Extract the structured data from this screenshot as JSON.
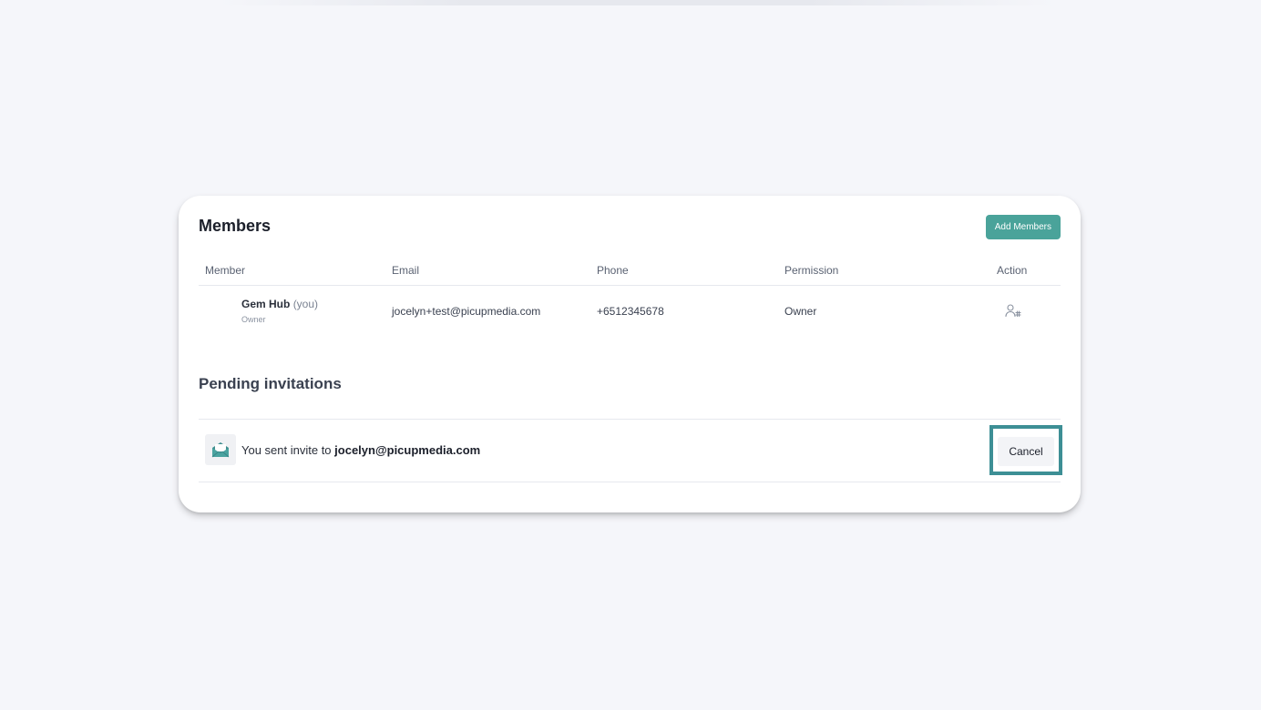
{
  "members": {
    "title": "Members",
    "add_button_label": "Add Members",
    "columns": [
      "Member",
      "Email",
      "Phone",
      "Permission",
      "Action"
    ],
    "rows": [
      {
        "name": "Gem Hub",
        "you_tag": "(you)",
        "role": "Owner",
        "email": "jocelyn+test@picupmedia.com",
        "phone": "+6512345678",
        "permission": "Owner",
        "action_icon": "user-settings-icon"
      }
    ]
  },
  "pending": {
    "title": "Pending invitations",
    "invites": [
      {
        "prefix": "You sent invite to ",
        "email": "jocelyn@picupmedia.com",
        "icon": "open-envelope-icon",
        "cancel_label": "Cancel"
      }
    ]
  },
  "colors": {
    "accent": "#4aa39a",
    "highlight_border": "#3d8f95",
    "background": "#f5f6fa"
  }
}
